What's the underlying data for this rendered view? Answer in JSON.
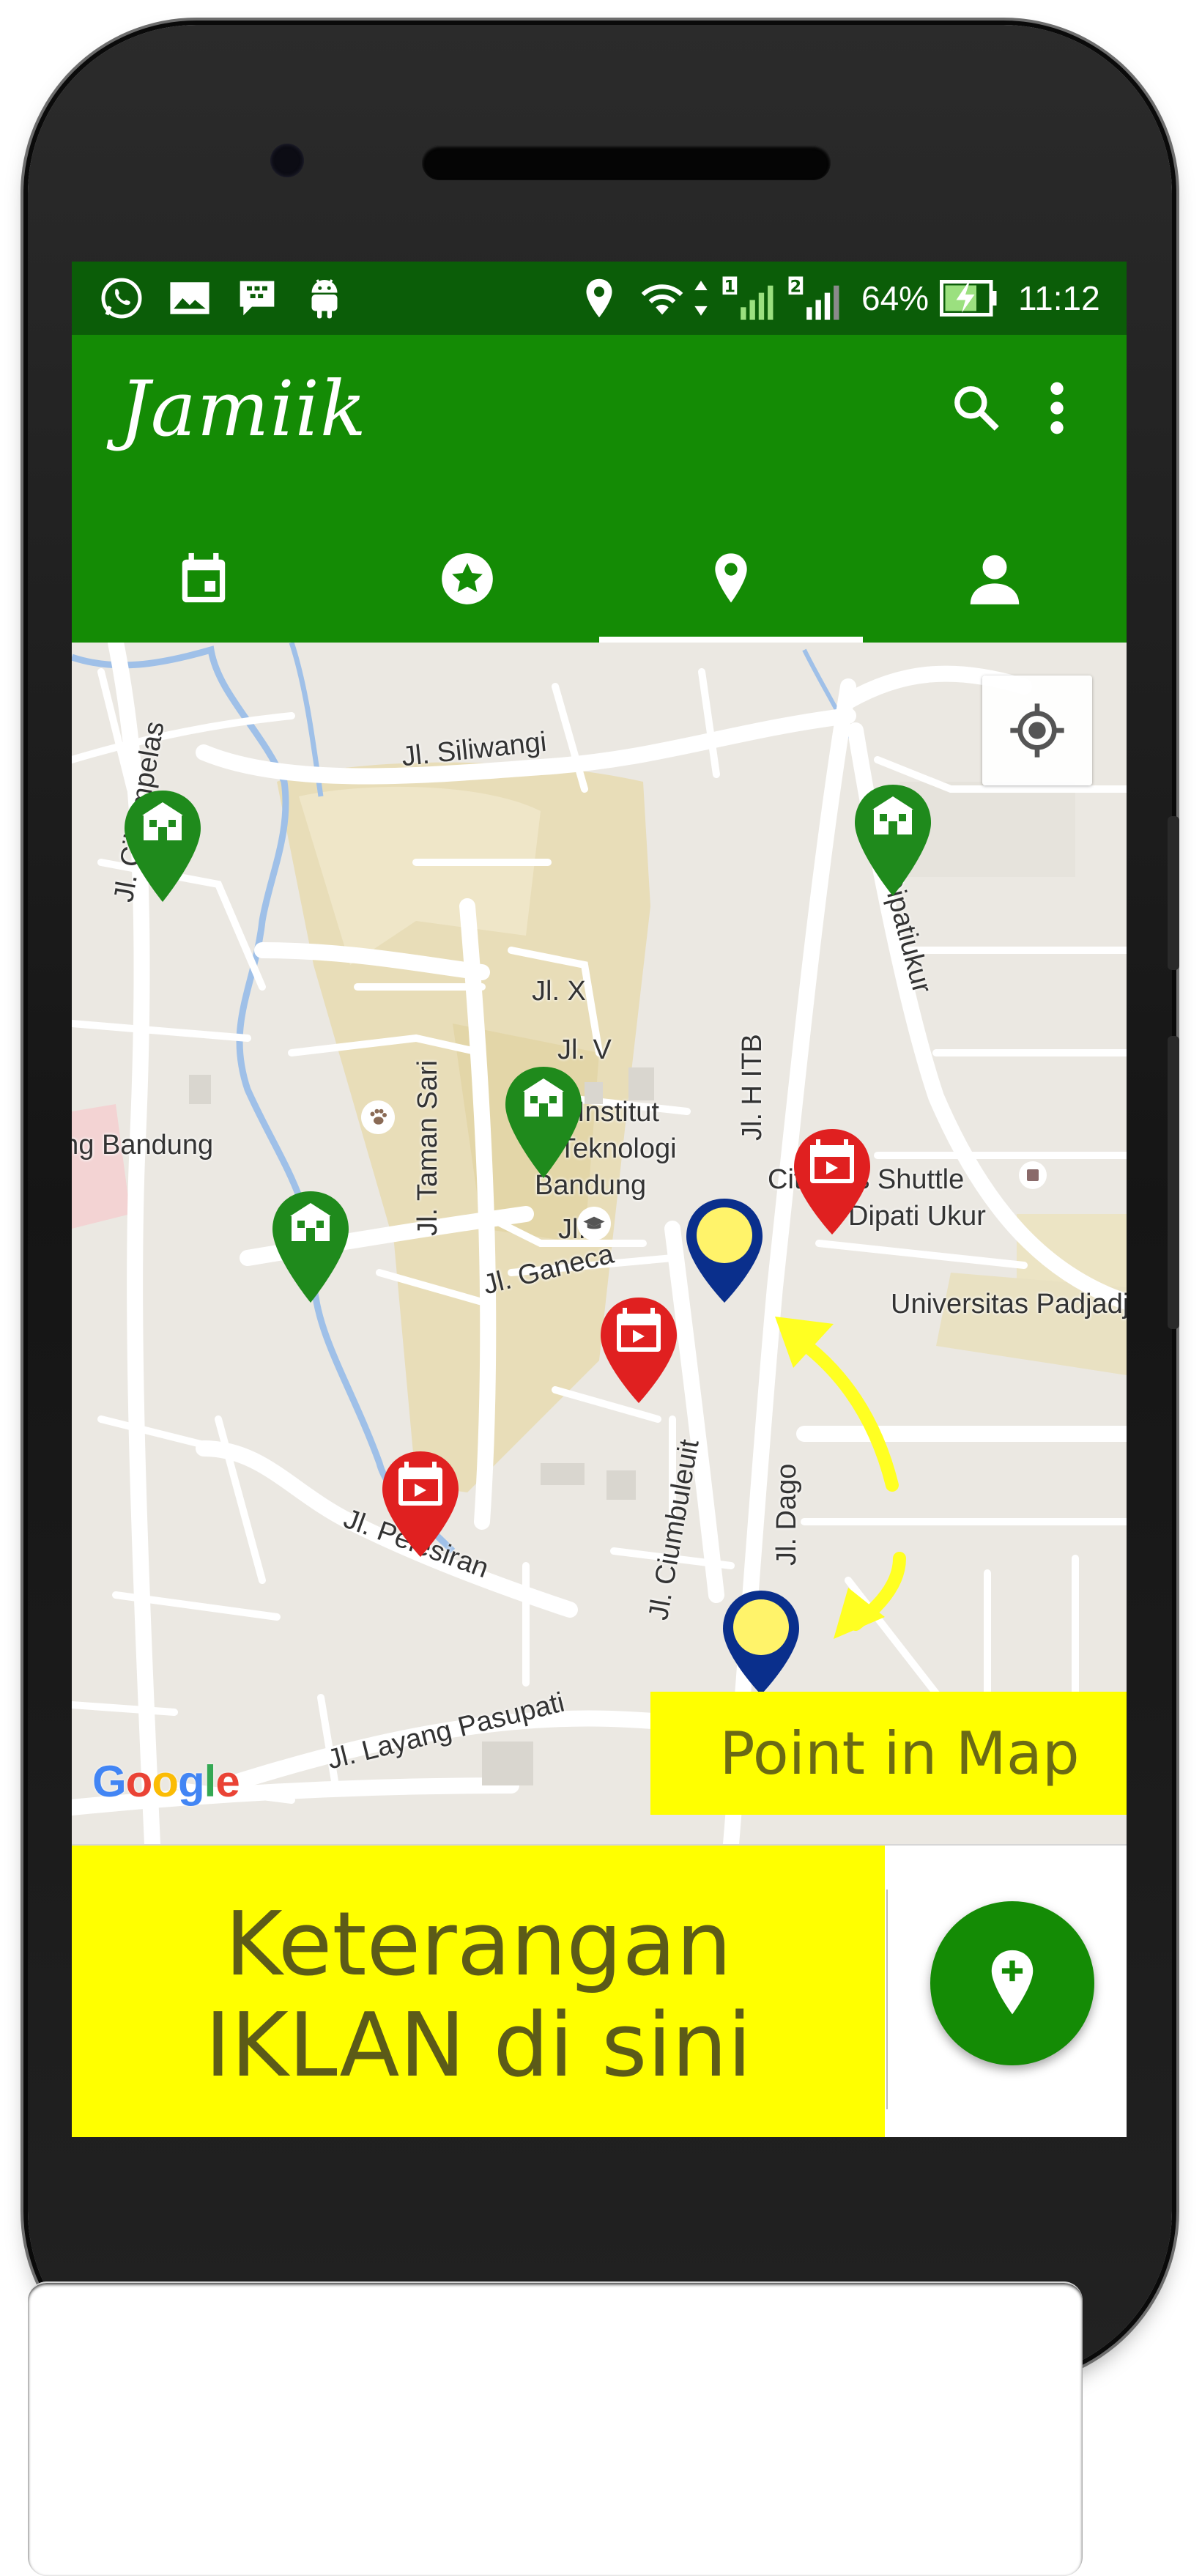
{
  "status_bar": {
    "battery": "64%",
    "time": "11:12",
    "sim1": "1",
    "sim2": "2",
    "icons": [
      "whatsapp-icon",
      "gallery-icon",
      "bbm-icon",
      "android-icon",
      "location-icon",
      "wifi-icon",
      "signal-icon",
      "battery-charging-icon"
    ]
  },
  "app_bar": {
    "title": "Jamiik",
    "icons": [
      "search-icon",
      "more-vert-icon"
    ]
  },
  "tabs": [
    {
      "icon": "calendar-icon",
      "active": false
    },
    {
      "icon": "star-icon",
      "active": false
    },
    {
      "icon": "map-pin-icon",
      "active": true
    },
    {
      "icon": "person-icon",
      "active": false
    }
  ],
  "map": {
    "labels": {
      "siliwangi": "Jl. Siliwangi",
      "cihampelas": "Jl. Cihampelas",
      "dipatiukur": "Jl. Dipatiukur",
      "jlx": "Jl. X",
      "jlv": "Jl. V",
      "hitb": "Jl. H ITB",
      "institut_1": "Institut",
      "institut_2": "Teknologi",
      "institut_3": "Bandung",
      "tamansari": "Jl. Taman Sari",
      "binatang": "Kebun Binatang Bandung",
      "ganeca": "Jl. Ganeca",
      "jli": "Jl. I",
      "citi": "Cititrans Shuttle",
      "citi2": "Dipati Ukur",
      "unpad": "Universitas Padjadjaran",
      "pelesiran": "Jl. Pelesiran",
      "ciumbuleuit": "Jl. Ciumbuleuit",
      "layang": "Jl. Layang Pasupati",
      "jld": "Jl. Dago"
    },
    "google": {
      "text": "Google",
      "colors": [
        "#4285F4",
        "#EA4335",
        "#FBBC05",
        "#4285F4",
        "#34A853",
        "#EA4335"
      ]
    },
    "locate_icon": "my-location-icon",
    "marker_types": {
      "mosque": "#1f8a1c",
      "event": "#e02020",
      "point": "#0a2f8c"
    },
    "callout": "Point in Map"
  },
  "ad_banner": {
    "line1": "Keterangan",
    "line2": "IKLAN di sini"
  },
  "fab": {
    "icon": "add-location-icon"
  }
}
